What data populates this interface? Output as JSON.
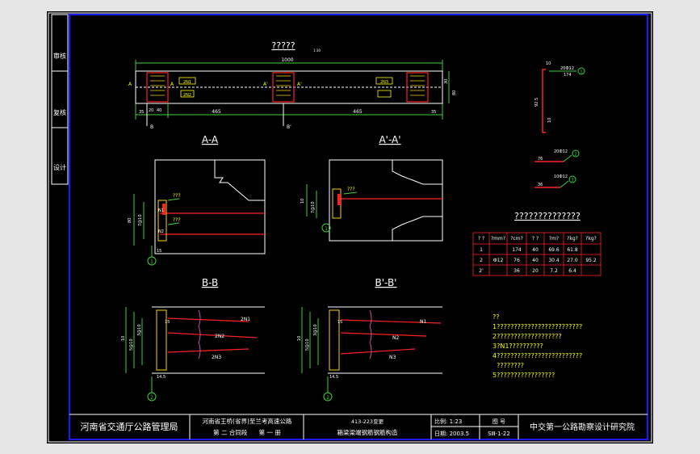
{
  "colors": {
    "background": "#000000",
    "frame": "#1a1aff",
    "geometry": "#ffffff",
    "dimension": "#3cd23c",
    "label": "#ffff00",
    "rebar": "#ff2020",
    "table": "#ff2020",
    "outer": "#e6e6e6"
  },
  "side_strip": [
    "审核",
    "复核",
    "设计"
  ],
  "plan": {
    "title": "?????",
    "scale_note": "1:30",
    "total_dim": "1000",
    "left_dims": [
      "35",
      "20",
      "40"
    ],
    "span_left": "465",
    "span_right": "465",
    "right_dim": "35",
    "height_dims": [
      "30",
      "80"
    ],
    "bolt_labels": [
      "2N1",
      "2N2",
      "2N3"
    ],
    "cut_labels": [
      "A",
      "A",
      "A'",
      "A'",
      "B",
      "B",
      "B'",
      "B'"
    ]
  },
  "section_aa": {
    "title": "A-A",
    "notes": [
      "???",
      "???"
    ],
    "bar_labels": [
      "N1",
      "N2"
    ],
    "dims": [
      "80",
      "7@10",
      "15"
    ],
    "circle": "1"
  },
  "section_aa2": {
    "title": "A'-A'",
    "note": "???",
    "bar_label": "N1",
    "dims": [
      "10",
      "7@10"
    ],
    "circle": "1"
  },
  "section_bb": {
    "title": "B-B",
    "bar_labels": [
      "2N1",
      "2N2",
      "2N3"
    ],
    "dims": [
      "10",
      "10",
      "10",
      "10",
      "15",
      "17.5",
      "14.5",
      "10",
      "3@10",
      "5@10"
    ],
    "circle": "2"
  },
  "section_bb2": {
    "title": "B'-B'",
    "bar_labels": [
      "N1",
      "N2",
      "N3"
    ],
    "dims": [
      "10",
      "10",
      "10",
      "10",
      "15",
      "17.5",
      "14.5",
      "10",
      "3@10",
      "5@10"
    ],
    "circle": "2"
  },
  "rebar_details": {
    "n1": {
      "label": "20Ф12",
      "circle": "1",
      "length": "174",
      "dim_left": "92.5",
      "dim_top": "10",
      "dim_bottom": "10"
    },
    "n2": {
      "label": "20Ф12",
      "circle": "2",
      "length": "76"
    },
    "n3": {
      "label": "10Ф12",
      "circle": "3",
      "length": "36"
    }
  },
  "table": {
    "title": "??????????????",
    "headers": [
      "? ?",
      "?mm?",
      "?cm?",
      "? ?",
      "?m?",
      "?kg?",
      "?kg?"
    ],
    "rows": [
      [
        "1",
        "",
        "174",
        "40",
        "69.6",
        "61.8",
        ""
      ],
      [
        "2",
        "Ф12",
        "76",
        "40",
        "30.4",
        "27.0",
        "95.2"
      ],
      [
        "2'",
        "",
        "36",
        "20",
        "7.2",
        "6.4",
        ""
      ]
    ]
  },
  "notes": {
    "heading": "??",
    "lines": [
      "1?????????????????????????",
      "2???????????????????",
      "3?N1??????????",
      "4?????????????????????????",
      "  ????????",
      "5?????????????????"
    ]
  },
  "title_block": {
    "org": "河南省交通厅公路管理局",
    "project_line1": "河南省王桥(省界)至兰考高速公路",
    "project_line2": "第 二 合同段      第 一 册",
    "drawing_line1": "413-223变更",
    "drawing_line2": "箱梁梁端钢筋钢筋构造",
    "scale_label": "比例: 1:23",
    "date_label": "日期: 2003.5",
    "sheet_label": "图 号",
    "sheet_no": "SⅢ-1-22",
    "institute": "中交第一公路勘察设计研究院"
  }
}
